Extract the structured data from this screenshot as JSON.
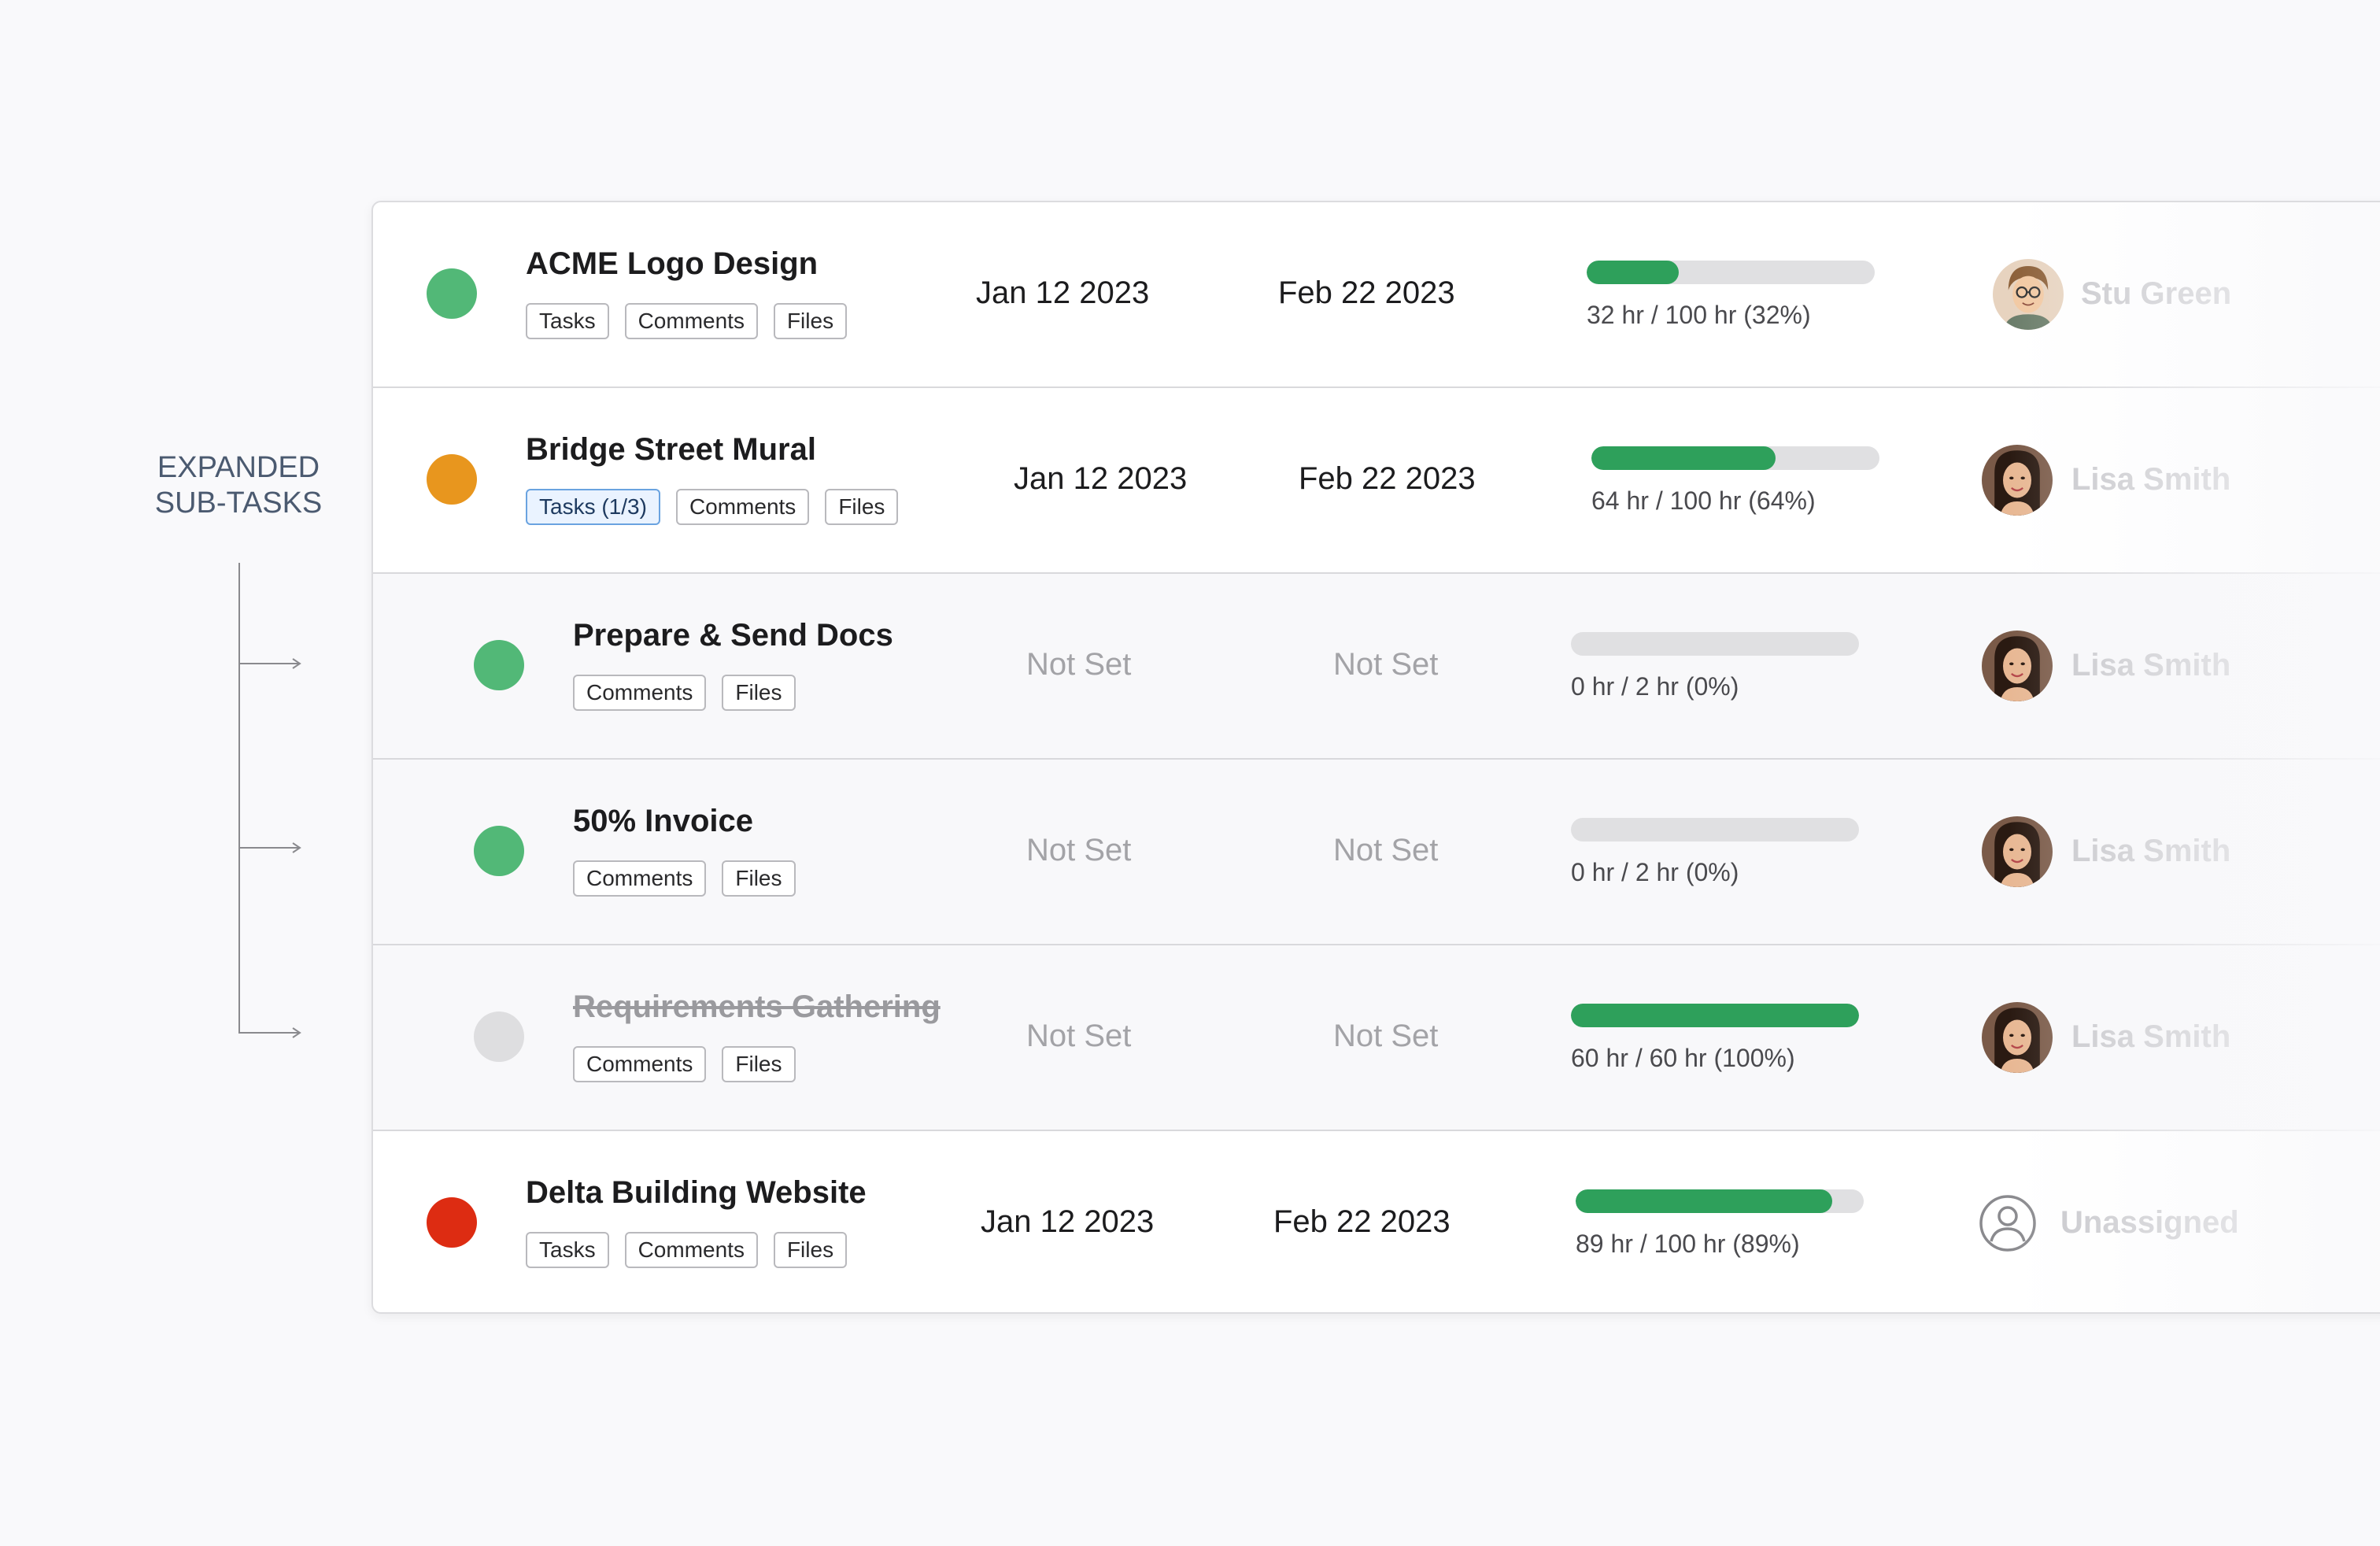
{
  "annotation": {
    "label": "EXPANDED\nSUB-TASKS"
  },
  "colors": {
    "green": "#52b877",
    "orange": "#e8961e",
    "red": "#dd2c12",
    "grey": "#dedee0",
    "progress": "#2ea05b",
    "chip_active_border": "#6aa3e0"
  },
  "rows": [
    {
      "status_color": "#52b877",
      "title": "ACME Logo Design",
      "chips": [
        "Tasks",
        "Comments",
        "Files"
      ],
      "start": "Jan 12 2023",
      "end": "Feb 22 2023",
      "progress": 0.32,
      "hours": "32 hr / 100 hr (32%)",
      "assignee": "Stu Green",
      "avatar_icon": "avatar-man-glasses"
    },
    {
      "status_color": "#e8961e",
      "title": "Bridge Street Mural",
      "chips": [
        "Tasks (1/3)",
        "Comments",
        "Files"
      ],
      "start": "Jan 12 2023",
      "end": "Feb 22 2023",
      "progress": 0.64,
      "hours": "64 hr / 100 hr (64%)",
      "assignee": "Lisa Smith",
      "avatar_icon": "avatar-woman"
    },
    {
      "status_color": "#52b877",
      "title": "Prepare & Send Docs",
      "chips": [
        "Comments",
        "Files"
      ],
      "start": "Not Set",
      "end": "Not Set",
      "progress": 0,
      "hours": "0 hr / 2 hr (0%)",
      "assignee": "Lisa Smith",
      "avatar_icon": "avatar-woman"
    },
    {
      "status_color": "#52b877",
      "title": "50% Invoice",
      "chips": [
        "Comments",
        "Files"
      ],
      "start": "Not Set",
      "end": "Not Set",
      "progress": 0,
      "hours": "0 hr / 2 hr (0%)",
      "assignee": "Lisa Smith",
      "avatar_icon": "avatar-woman"
    },
    {
      "status_color": "#dedee0",
      "title": "Requirements Gathering",
      "chips": [
        "Comments",
        "Files"
      ],
      "start": "Not Set",
      "end": "Not Set",
      "progress": 1.0,
      "hours": "60 hr / 60 hr (100%)",
      "assignee": "Lisa Smith",
      "avatar_icon": "avatar-woman"
    },
    {
      "status_color": "#dd2c12",
      "title": "Delta Building Website",
      "chips": [
        "Tasks",
        "Comments",
        "Files"
      ],
      "start": "Jan 12 2023",
      "end": "Feb 22 2023",
      "progress": 0.89,
      "hours": "89 hr / 100 hr (89%)",
      "assignee": "Unassigned",
      "avatar_icon": "unassigned-user-icon"
    }
  ]
}
